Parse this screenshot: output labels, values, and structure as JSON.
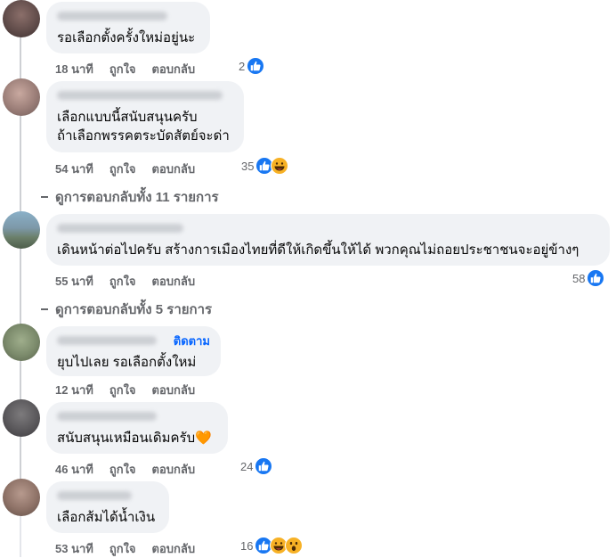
{
  "comments": [
    {
      "text_lines": [
        "รอเลือกตั้งครั้งใหม่อยู่นะ"
      ],
      "time": "18 นาที",
      "like_label": "ถูกใจ",
      "reply_label": "ตอบกลับ",
      "reaction_count": "2",
      "reactions": [
        "like-icon"
      ]
    },
    {
      "text_lines": [
        "เลือกแบบนี้สนับสนุนครับ",
        "ถ้าเลือกพรรคตระบัดสัตย์จะด่า"
      ],
      "time": "54 นาที",
      "like_label": "ถูกใจ",
      "reply_label": "ตอบกลับ",
      "reaction_count": "35",
      "reactions": [
        "like-icon",
        "haha-icon"
      ],
      "view_replies": "ดูการตอบกลับทั้ง 11 รายการ"
    },
    {
      "text_lines": [
        "เดินหน้าต่อไปครับ สร้างการเมืองไทยที่ดีให้เกิดขึ้นให้ได้ พวกคุณไม่ถอยประชาชนจะอยู่ข้างๆ"
      ],
      "time": "55 นาที",
      "like_label": "ถูกใจ",
      "reply_label": "ตอบกลับ",
      "reaction_count": "58",
      "reactions": [
        "like-icon"
      ],
      "view_replies": "ดูการตอบกลับทั้ง 5 รายการ"
    },
    {
      "text_lines": [
        "ยุบไปเลย รอเลือกตั้งใหม่"
      ],
      "follow_label": "ติดตาม",
      "time": "12 นาที",
      "like_label": "ถูกใจ",
      "reply_label": "ตอบกลับ",
      "reaction_count": "",
      "reactions": []
    },
    {
      "text_lines": [
        "สนับสนุนเหมือนเดิมครับ🧡"
      ],
      "time": "46 นาที",
      "like_label": "ถูกใจ",
      "reply_label": "ตอบกลับ",
      "reaction_count": "24",
      "reactions": [
        "like-icon"
      ]
    },
    {
      "text_lines": [
        "เลือกส้มได้น้ำเงิน"
      ],
      "time": "53 นาที",
      "like_label": "ถูกใจ",
      "reply_label": "ตอบกลับ",
      "reaction_count": "16",
      "reactions": [
        "like-icon",
        "haha-icon",
        "wow-icon"
      ]
    }
  ],
  "colors": {
    "bubble": "#f0f2f5",
    "meta_text": "#65676b",
    "like_blue": "#1877f2",
    "follow_blue": "#0866ff",
    "heart_orange": "#f5821f"
  }
}
